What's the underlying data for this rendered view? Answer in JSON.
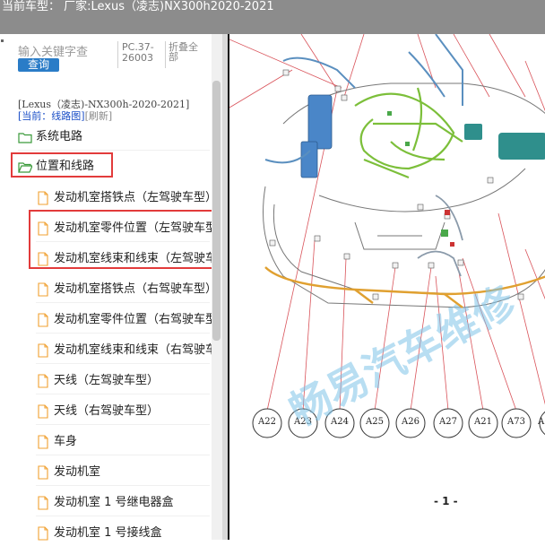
{
  "title_bar": {
    "text": "当前车型： 厂家:Lexus（凌志)NX300h2020-2021"
  },
  "search": {
    "placeholder": "输入关键字查",
    "button": "查询"
  },
  "meta": {
    "pc": "PC.37-26003",
    "fold_all": "折叠全部"
  },
  "breadcrumb": {
    "model": "[Lexus（凌志)-NX300h-2020-2021]",
    "current": "[当前：线路图]",
    "refresh": "[刷新]"
  },
  "tree": {
    "folders": [
      {
        "label": "系统电路",
        "open": false
      },
      {
        "label": "位置和线路",
        "open": true
      }
    ],
    "items": [
      "发动机室搭铁点（左驾驶车型）",
      "发动机室零件位置（左驾驶车型）",
      "发动机室线束和线束（左驾驶车型）",
      "发动机室搭铁点（右驾驶车型）",
      "发动机室零件位置（右驾驶车型）",
      "发动机室线束和线束（右驾驶车型）",
      "天线（左驾驶车型）",
      "天线（右驾驶车型）",
      "车身",
      "发动机室",
      "发动机室 1 号继电器盒",
      "发动机室 1 号接线盒"
    ]
  },
  "diagram": {
    "connectors": [
      "A22",
      "A23",
      "A24",
      "A25",
      "A26",
      "A27",
      "A21",
      "A73",
      "A"
    ],
    "page_label": "- 1 -",
    "watermark": "畅易汽车维修"
  },
  "colors": {
    "highlight": "#e23b3b",
    "folder": "#3a9a3a",
    "doc": "#f0a030",
    "button": "#2a7cc7",
    "title_bg": "#8c8c8c"
  }
}
